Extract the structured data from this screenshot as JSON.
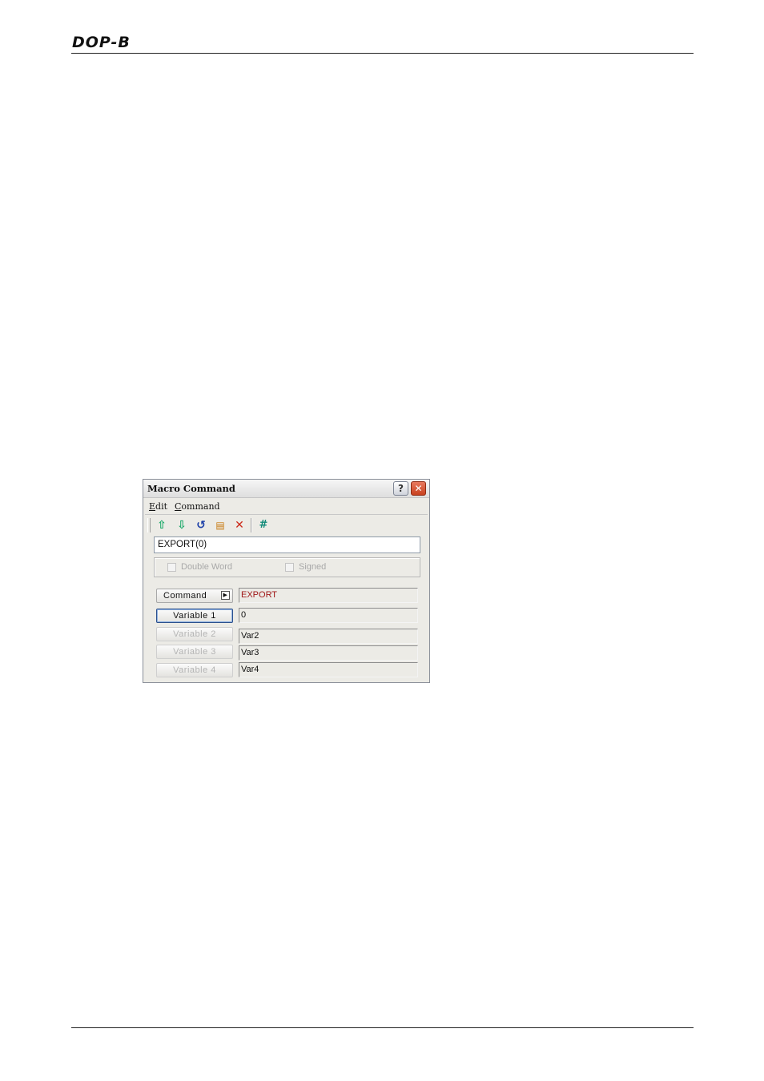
{
  "page": {
    "header_logo": "DOP-B"
  },
  "dialog": {
    "title": "Macro Command",
    "help_button": "?",
    "close_button": "✕",
    "menu": [
      "Edit",
      "Command"
    ],
    "toolbar": {
      "icons": [
        "move-up-icon",
        "move-down-icon",
        "undo-icon",
        "document-icon",
        "delete-icon",
        "hash-icon"
      ],
      "hash_label": "#"
    },
    "expression": "EXPORT(0)",
    "options": {
      "double_word_label": "Double Word",
      "double_word_checked": false,
      "signed_label": "Signed",
      "signed_checked": false
    },
    "rows": {
      "command_label": "Command",
      "command_value": "EXPORT",
      "variable1_label": "Variable 1",
      "variable1_value": "0",
      "variable2_label": "Variable 2",
      "variable2_value": "Var2",
      "variable3_label": "Variable 3",
      "variable3_value": "Var3",
      "variable4_label": "Variable 4",
      "variable4_value": "Var4"
    },
    "colors": {
      "command_value_text": "#a01818",
      "arrow_icons": "#18a868",
      "close_button": "#c8411f"
    }
  }
}
